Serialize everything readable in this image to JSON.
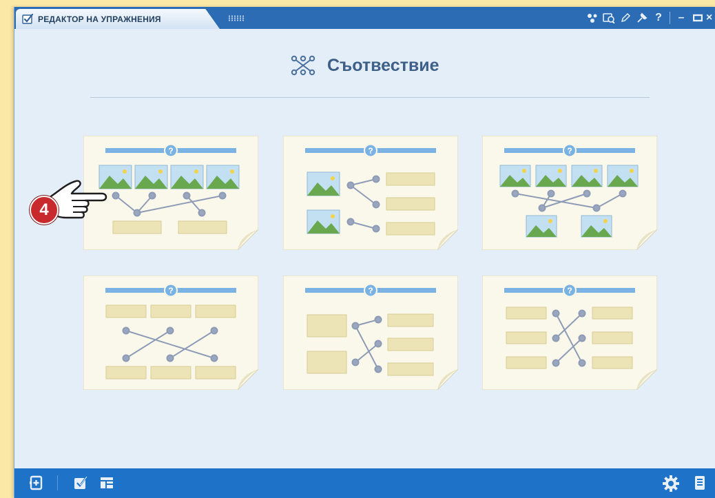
{
  "window": {
    "title": "РЕДАКТОР НА УПРАЖНЕНИЯ"
  },
  "titlebar_icons": [
    "share-icon",
    "preview-icon",
    "edit-icon",
    "pin-icon",
    "help-icon",
    "minimize-icon",
    "maximize-icon",
    "close-icon"
  ],
  "titlebar_glyphs": {
    "help": "?",
    "minimize": "–",
    "close": "×"
  },
  "page": {
    "heading": "Съотвествие",
    "heading_icon": "matching-icon"
  },
  "step_badge": "4",
  "templates": [
    {
      "id": "img-to-text-top-bottom"
    },
    {
      "id": "img-to-text-left-right"
    },
    {
      "id": "img-to-img-top-bottom"
    },
    {
      "id": "text-to-text-top-bottom"
    },
    {
      "id": "text-to-text-left-right-big"
    },
    {
      "id": "text-to-text-three-columns"
    }
  ],
  "bottombar_icons": [
    "add-page-icon",
    "check-exercise-icon",
    "layout-icon",
    "settings-icon",
    "notes-icon"
  ],
  "colors": {
    "titlebar": "#2b6cb4",
    "bottombar": "#1e73c9",
    "background": "#e4eef8",
    "accent": "#7ab3e3",
    "badge": "#c8292d",
    "card": "#faf8ea",
    "connector": "#8d9bb6",
    "text_block": "#ece3b6"
  }
}
